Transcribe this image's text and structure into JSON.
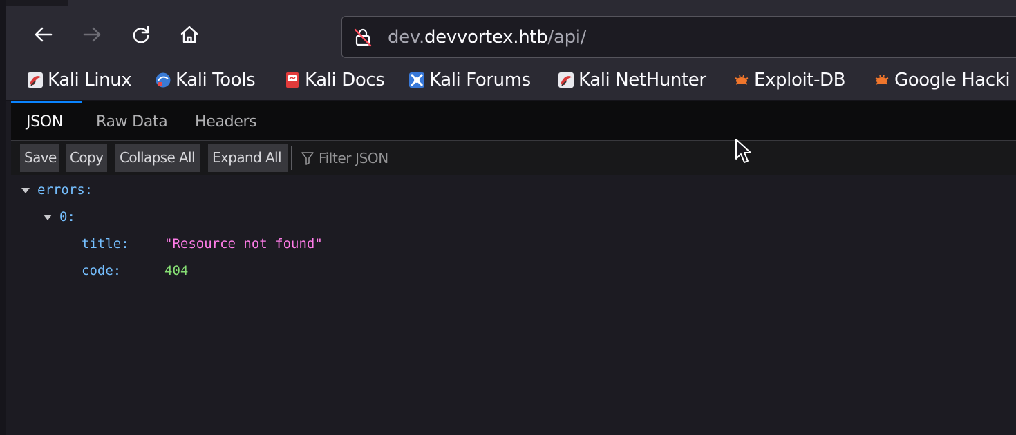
{
  "browser": {
    "url_host_prefix": "dev.",
    "url_host_main": "devvortex.htb",
    "url_path": "/api/",
    "icons": [
      "back-arrow-icon",
      "forward-arrow-icon",
      "reload-icon",
      "home-icon",
      "insecure-lock-icon"
    ]
  },
  "bookmarks": [
    {
      "label": "Kali Linux",
      "icon": "kali-dragon-icon"
    },
    {
      "label": "Kali Tools",
      "icon": "kali-tools-icon"
    },
    {
      "label": "Kali Docs",
      "icon": "kali-docs-icon"
    },
    {
      "label": "Kali Forums",
      "icon": "kali-forums-icon"
    },
    {
      "label": "Kali NetHunter",
      "icon": "kali-dragon-icon"
    },
    {
      "label": "Exploit-DB",
      "icon": "exploit-db-bug-icon"
    },
    {
      "label": "Google Hacki",
      "icon": "exploit-db-bug-icon"
    }
  ],
  "viewer": {
    "tabs": [
      "JSON",
      "Raw Data",
      "Headers"
    ],
    "active_tab": "JSON",
    "toolbar": {
      "save": "Save",
      "copy": "Copy",
      "collapse_all": "Collapse All",
      "expand_all": "Expand All",
      "filter_placeholder": "Filter JSON"
    }
  },
  "json": {
    "root_key": "errors:",
    "index_key": "0:",
    "title_key": "title:",
    "title_value": "\"Resource not found\"",
    "code_key": "code:",
    "code_value": "404"
  },
  "colors": {
    "key": "#75bfff",
    "string": "#ff7de9",
    "number": "#86de74",
    "accent": "#0a84ff"
  }
}
